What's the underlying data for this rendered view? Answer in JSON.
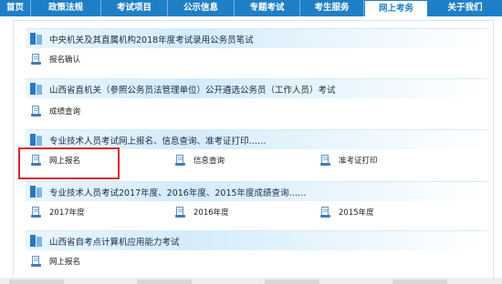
{
  "nav": {
    "items": [
      {
        "label": "首页",
        "active": false
      },
      {
        "label": "政策法规",
        "active": false
      },
      {
        "label": "考试项目",
        "active": false
      },
      {
        "label": "公示信息",
        "active": false
      },
      {
        "label": "专题考试",
        "active": false
      },
      {
        "label": "考生服务",
        "active": false
      },
      {
        "label": "网上考务",
        "active": true
      },
      {
        "label": "关于我们",
        "active": false
      }
    ]
  },
  "sections": [
    {
      "title": "中央机关及其直属机构2018年度考试录用公务员笔试",
      "items": [
        "报名确认"
      ]
    },
    {
      "title": "山西省直机关（参照公务员法管理单位）公开遴选公务员（工作人员）考试",
      "items": [
        "成绩查询"
      ]
    },
    {
      "title": "专业技术人员考试网上报名、信息查询、准考证打印……",
      "items": [
        "网上报名",
        "信息查询",
        "准考证打印"
      ]
    },
    {
      "title": "专业技术人员考试2017年度、2016年度、2015年度成绩查询……",
      "items": [
        "2017年度",
        "2016年度",
        "2015年度"
      ]
    },
    {
      "title": "山西省自考点计算机应用能力考试",
      "items": [
        "网上报名"
      ]
    }
  ],
  "colors": {
    "nav_bg": "#1e7fc6",
    "highlight": "#d9282e"
  }
}
